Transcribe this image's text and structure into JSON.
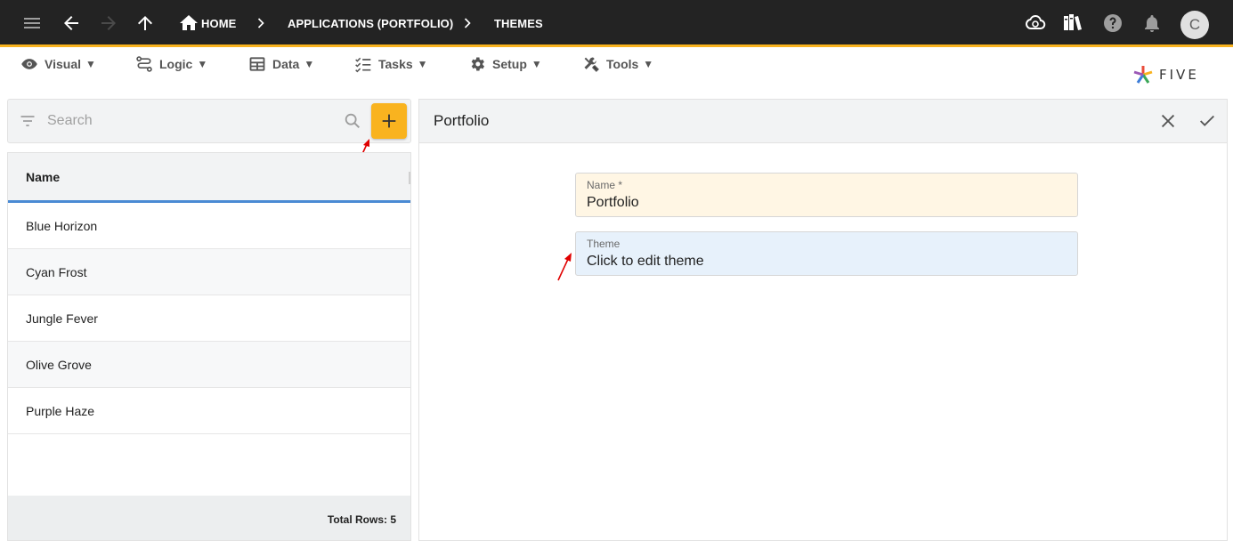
{
  "topbar": {
    "breadcrumbs": [
      "HOME",
      "APPLICATIONS (PORTFOLIO)",
      "THEMES"
    ],
    "avatar_letter": "C",
    "icons": [
      "menu-icon",
      "back-arrow-icon",
      "forward-arrow-icon",
      "up-arrow-icon",
      "home-icon",
      "cloud-sync-icon",
      "books-icon",
      "help-icon",
      "bell-icon"
    ],
    "accent_color": "#f9b31f",
    "bar_color": "#232323"
  },
  "menubar": {
    "items": [
      {
        "label": "Visual",
        "icon": "eye-icon"
      },
      {
        "label": "Logic",
        "icon": "flow-icon"
      },
      {
        "label": "Data",
        "icon": "table-icon"
      },
      {
        "label": "Tasks",
        "icon": "checklist-icon"
      },
      {
        "label": "Setup",
        "icon": "gear-icon"
      },
      {
        "label": "Tools",
        "icon": "wrench-icon"
      }
    ],
    "caret": "▼",
    "logo_text": "FIVE"
  },
  "left": {
    "search_placeholder": "Search",
    "column_header": "Name",
    "rows": [
      "Blue Horizon",
      "Cyan Frost",
      "Jungle Fever",
      "Olive Grove",
      "Purple Haze"
    ],
    "footer": "Total Rows: 5"
  },
  "right": {
    "title": "Portfolio",
    "fields": [
      {
        "label": "Name *",
        "value": "Portfolio"
      },
      {
        "label": "Theme",
        "value": "Click to edit theme"
      }
    ]
  }
}
